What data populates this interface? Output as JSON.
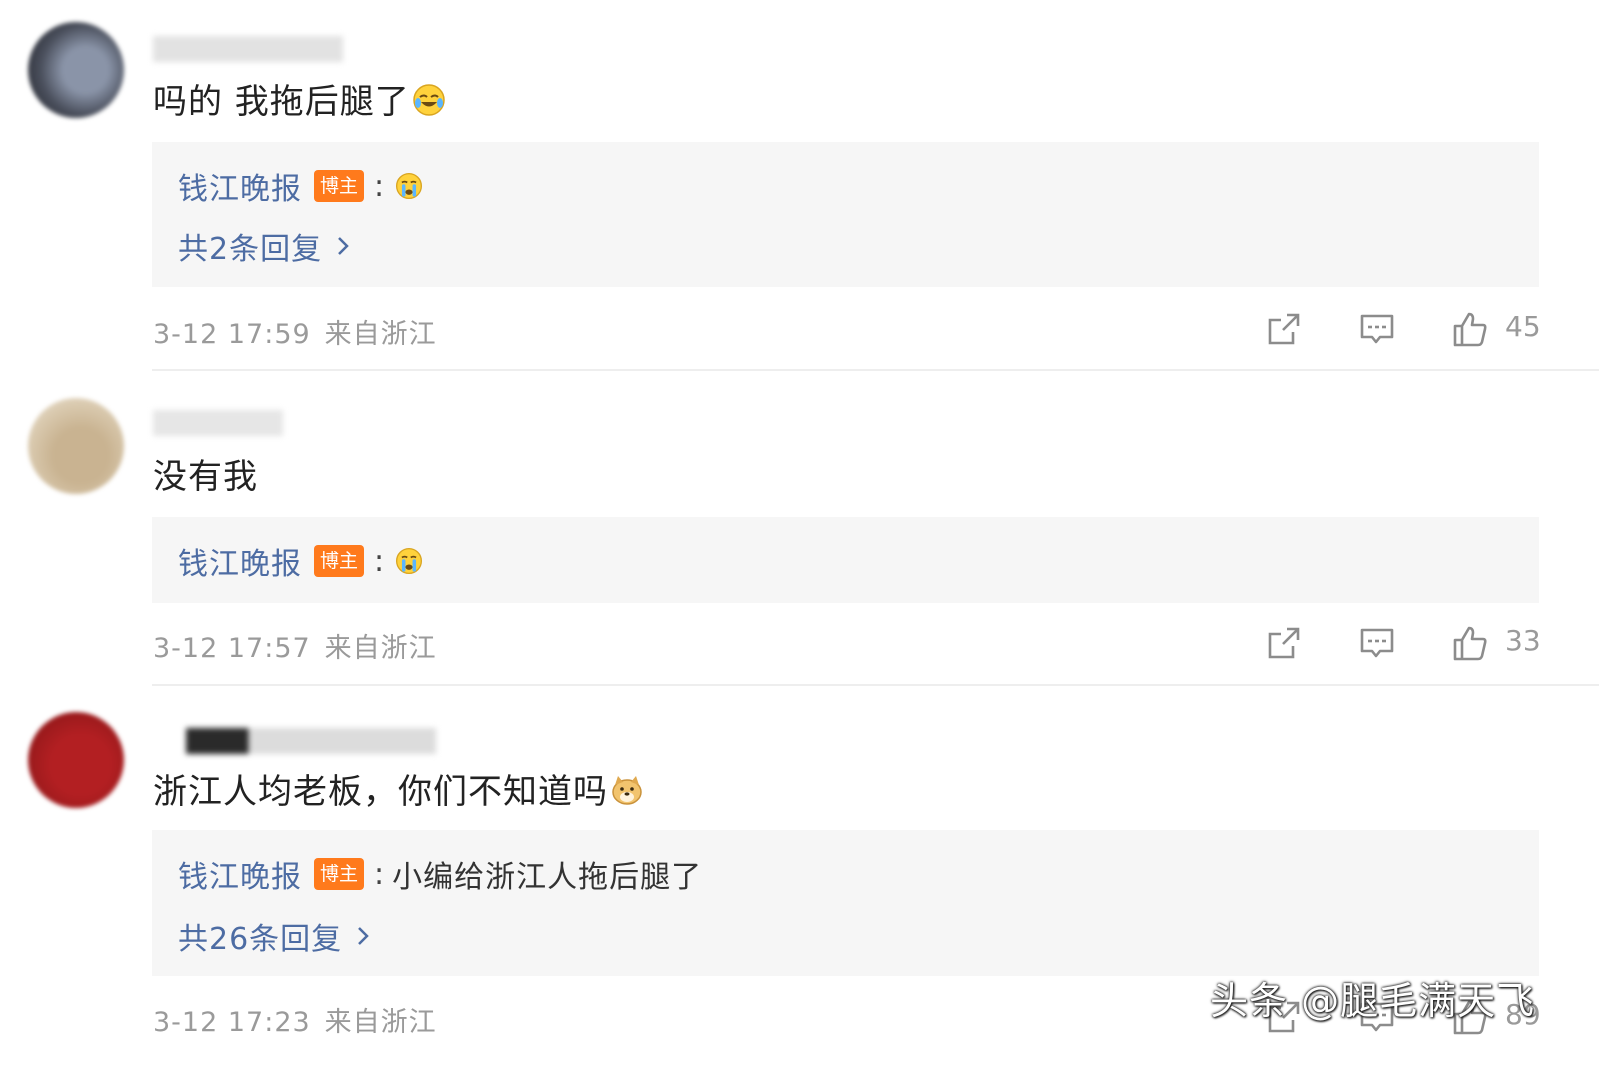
{
  "comments": [
    {
      "content": "吗的 我拖后腿了",
      "emoji": "laughing-crying-emoji",
      "reply": {
        "author": "钱江晚报",
        "badge": "博主",
        "colon": ":",
        "text": "",
        "text_emoji": "crying-emoji",
        "count_label": "共2条回复"
      },
      "time": "3-12 17:59",
      "location": "来自浙江",
      "likes": "45"
    },
    {
      "content": "没有我",
      "emoji": "",
      "reply": {
        "author": "钱江晚报",
        "badge": "博主",
        "colon": ":",
        "text": "",
        "text_emoji": "crying-emoji",
        "count_label": ""
      },
      "time": "3-12 17:57",
      "location": "来自浙江",
      "likes": "33"
    },
    {
      "content": "浙江人均老板，你们不知道吗",
      "emoji": "doge-emoji",
      "reply": {
        "author": "钱江晚报",
        "badge": "博主",
        "colon": ":",
        "text": "小编给浙江人拖后腿了",
        "text_emoji": "",
        "count_label": "共26条回复"
      },
      "time": "3-12 17:23",
      "location": "来自浙江",
      "likes": "89"
    }
  ],
  "watermark": "头条 @腿毛满天飞",
  "colors": {
    "link_blue": "#4d6ca3",
    "badge_orange": "#ff7a1c",
    "meta_gray": "#9a9a9a",
    "reply_bg": "#f6f6f6"
  }
}
